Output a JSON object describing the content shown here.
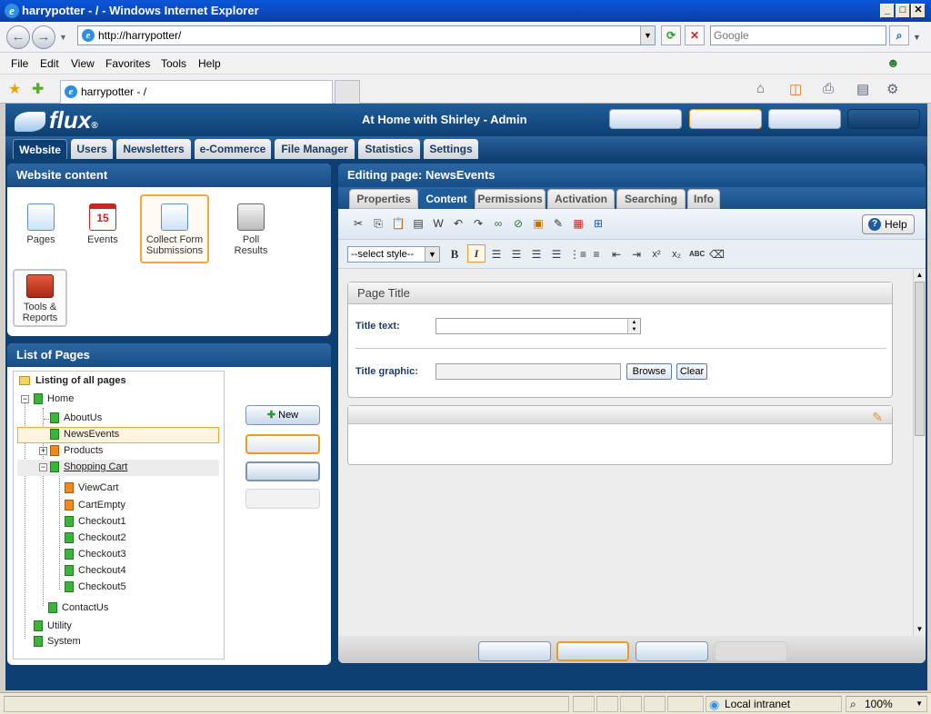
{
  "window": {
    "title": "harrypotter - / - Windows Internet Explorer"
  },
  "ie": {
    "address": "http://harrypotter/",
    "search_placeholder": "Google",
    "menu": [
      "File",
      "Edit",
      "View",
      "Favorites",
      "Tools",
      "Help"
    ],
    "tab_title": "harrypotter - /"
  },
  "app": {
    "logo": "flux",
    "logo_mark": "®",
    "title": "At Home with Shirley - Admin",
    "tabs": [
      "Website",
      "Users",
      "Newsletters",
      "e-Commerce",
      "File Manager",
      "Statistics",
      "Settings"
    ]
  },
  "website_content": {
    "header": "Website content",
    "tiles": [
      {
        "label1": "Pages",
        "label2": ""
      },
      {
        "label1": "Events",
        "label2": "",
        "badge": "15"
      },
      {
        "label1": "Collect Form",
        "label2": "Submissions"
      },
      {
        "label1": "Poll",
        "label2": "Results"
      },
      {
        "label1": "Tools &",
        "label2": "Reports"
      }
    ]
  },
  "pages": {
    "header": "List of Pages",
    "root": "Listing of all pages",
    "nodes": [
      "Home",
      "AboutUs",
      "NewsEvents",
      "Products",
      "Shopping Cart",
      "ViewCart",
      "CartEmpty",
      "Checkout1",
      "Checkout2",
      "Checkout3",
      "Checkout4",
      "Checkout5",
      "ContactUs",
      "Utility",
      "System"
    ],
    "new_button": "New"
  },
  "editor": {
    "header": "Editing page: NewsEvents",
    "tabs": [
      "Properties",
      "Content",
      "Permissions",
      "Activation",
      "Searching",
      "Info"
    ],
    "active_tab": "Content",
    "help": "Help",
    "style_select": "--select style--",
    "page_title_box": "Page Title",
    "title_text_label": "Title text:",
    "title_text_value": "",
    "title_graphic_label": "Title graphic:",
    "title_graphic_value": "",
    "browse": "Browse",
    "clear": "Clear"
  },
  "status": {
    "zone": "Local intranet",
    "zoom": "100%"
  }
}
